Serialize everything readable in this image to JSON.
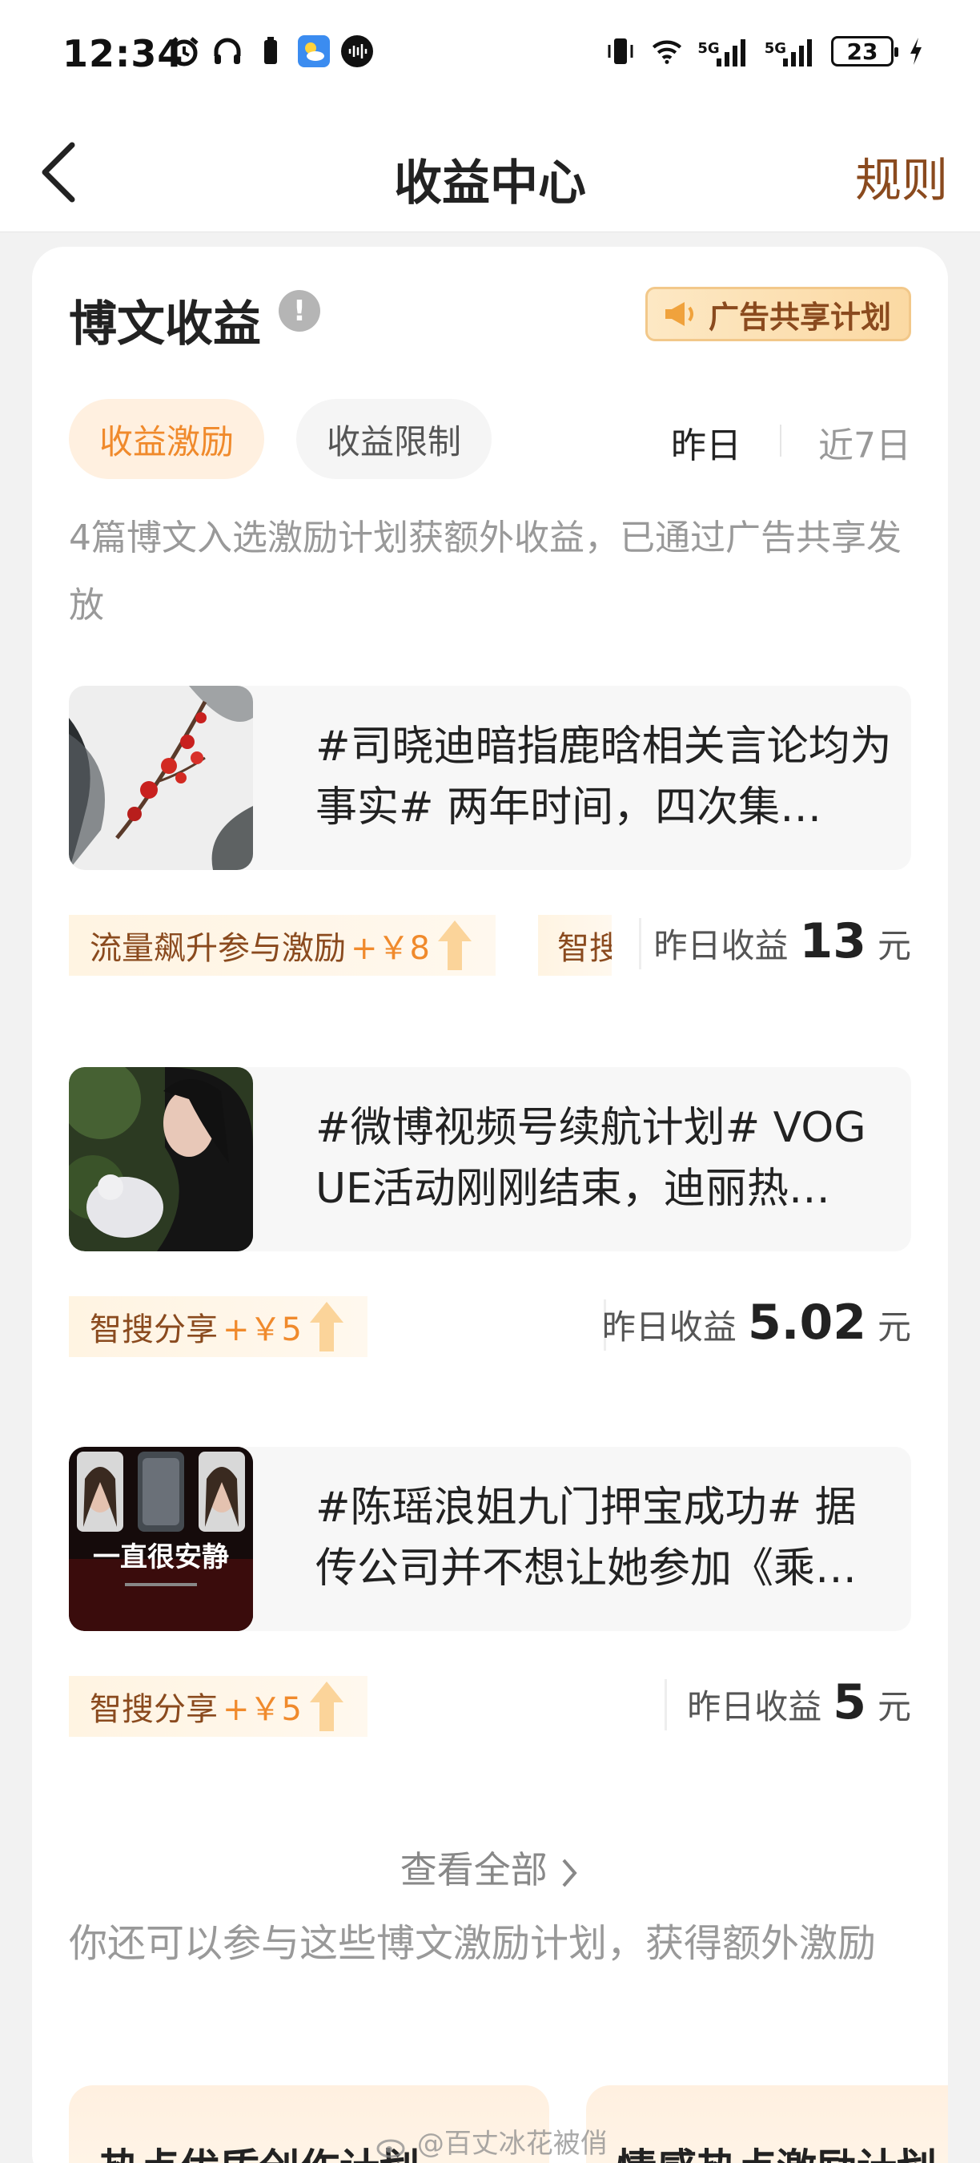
{
  "status_bar": {
    "time": "12:34",
    "icons_left": [
      "alarm-icon",
      "headphones-icon",
      "battery-small-icon",
      "weather-icon",
      "voice-icon"
    ],
    "icons_right": [
      "vibrate-icon",
      "wifi-icon",
      "signal-5g-icon",
      "signal-5g-icon",
      "battery-icon",
      "charging-icon"
    ],
    "signal_label_1": "5G",
    "signal_label_2": "5G",
    "battery_level": "23"
  },
  "header": {
    "title": "收益中心",
    "rules_label": "规则"
  },
  "card": {
    "title": "博文收益",
    "info_symbol": "!",
    "ad_plan_label": "广告共享计划",
    "tabs": [
      {
        "label": "收益激励",
        "active": true
      },
      {
        "label": "收益限制",
        "active": false
      }
    ],
    "period_yesterday": "昨日",
    "period_7d": "近7日",
    "notice": "4篇博文入选激励计划获额外收益，已通过广告共享发放",
    "earn_label": "昨日收益",
    "earn_unit": "元",
    "posts": [
      {
        "text": "#司晓迪暗指鹿晗相关言论均为事实# 两年时间，四次集…",
        "tags": [
          {
            "name": "流量飙升参与激励",
            "amount": "+￥8"
          },
          {
            "name": "智搜",
            "amount": ""
          }
        ],
        "earning": "13"
      },
      {
        "text": "#微博视频号续航计划# VOGUE活动刚刚结束，迪丽热…",
        "tags": [
          {
            "name": "智搜分享",
            "amount": "+￥5"
          }
        ],
        "earning": "5.02"
      },
      {
        "text": "#陈瑶浪姐九门押宝成功# 据传公司并不想让她参加《乘…",
        "thumb_caption": "一直很安静",
        "tags": [
          {
            "name": "智搜分享",
            "amount": "+￥5"
          }
        ],
        "earning": "5"
      }
    ],
    "view_all_label": "查看全部",
    "more_notice": "你还可以参与这些博文激励计划，获得额外激励",
    "plans": [
      {
        "label": "热点优质创作计划"
      },
      {
        "label": "情感热点激励计划"
      }
    ]
  },
  "watermark": "@百丈冰花被俏",
  "colors": {
    "accent": "#f08a2c",
    "brown": "#8a4a1e",
    "tag_bg": "#fff4e2",
    "muted": "#999999"
  }
}
